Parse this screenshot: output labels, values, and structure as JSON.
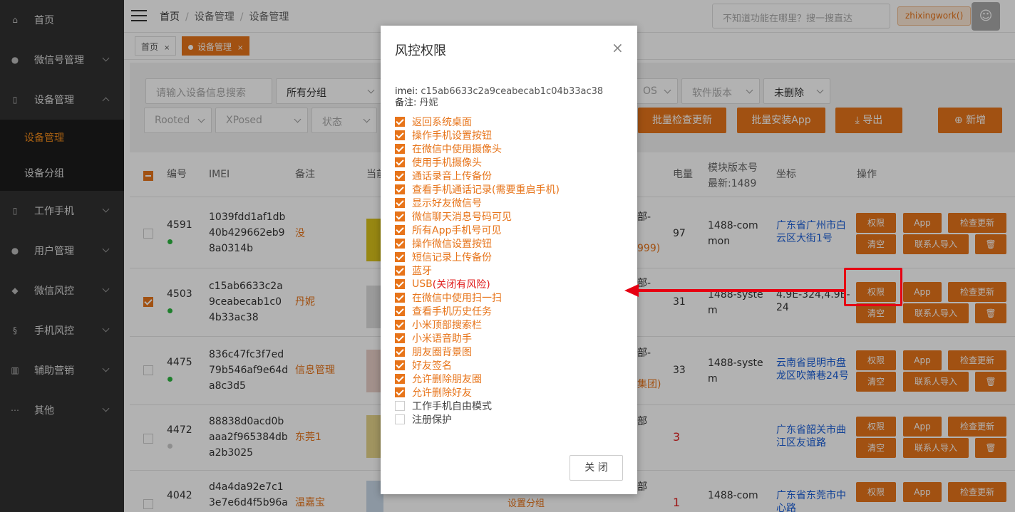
{
  "sidebar": {
    "items": [
      {
        "label": "首页",
        "icon": "home-icon"
      },
      {
        "label": "微信号管理",
        "icon": "wechat-icon"
      },
      {
        "label": "设备管理",
        "icon": "phone-icon"
      },
      {
        "label": "工作手机",
        "icon": "phone-icon"
      },
      {
        "label": "用户管理",
        "icon": "user-icon"
      },
      {
        "label": "微信风控",
        "icon": "shield-icon"
      },
      {
        "label": "手机风控",
        "icon": "fingerprint-icon"
      },
      {
        "label": "辅助营销",
        "icon": "chart-icon"
      },
      {
        "label": "其他",
        "icon": "more-icon"
      }
    ],
    "submenu": [
      "设备管理",
      "设备分组"
    ]
  },
  "header": {
    "breadcrumb": [
      "首页",
      "设备管理",
      "设备管理"
    ],
    "search_placeholder": "不知道功能在哪里？搜一搜直达",
    "user": "zhixingwork()"
  },
  "tabs": [
    {
      "label": "首页",
      "close": "×"
    },
    {
      "label": "设备管理",
      "close": "×"
    }
  ],
  "filters": {
    "search": "请输入设备信息搜索",
    "group": "所有分组",
    "os": "OS",
    "software": "软件版本",
    "deleted": "未删除",
    "rooted": "Rooted",
    "xposed": "XPosed",
    "status": "状态"
  },
  "actions": {
    "batch_check": "批量检查更新",
    "batch_install": "批量安装App",
    "export": "导出",
    "add": "新增"
  },
  "table": {
    "headers": {
      "id": "编号",
      "imei": "IMEI",
      "note": "备注",
      "current": "当前",
      "battery": "电量",
      "module": "模块版本号",
      "module_latest": "最新:1489",
      "coord": "坐标",
      "ops": "操作"
    },
    "rows": [
      {
        "id": "4591",
        "imei": [
          "1039fdd1af1db",
          "40b429662eb9",
          "8a0314b"
        ],
        "note": "没",
        "mid_top": "部-",
        "mid_bottom": "999)",
        "battery": "97",
        "module": [
          "1488-com",
          "mon"
        ],
        "coord": [
          "广东省广州市白",
          "云区大街1号"
        ],
        "online": true
      },
      {
        "id": "4503",
        "imei": [
          "c15ab6633c2a",
          "9ceabecab1c0",
          "4b33ac38"
        ],
        "note": "丹妮",
        "mid_top": "部-",
        "mid_bottom": "",
        "battery": "31",
        "module": [
          "1488-syste",
          "m"
        ],
        "coord": [
          "4.9E-324,4.9E-",
          "24"
        ],
        "online": true
      },
      {
        "id": "4475",
        "imei": [
          "836c47fc3f7ed",
          "79b546af9e64d",
          "a8c3d5"
        ],
        "note": "信息管理",
        "mid_top": "部-",
        "mid_bottom": "集团)",
        "battery": "33",
        "module": [
          "1488-syste",
          "m"
        ],
        "coord": [
          "云南省昆明市盘",
          "龙区吹箫巷24号"
        ],
        "online": true
      },
      {
        "id": "4472",
        "imei": [
          "88838d0acd0b",
          "aaa2f965384db",
          "a2b3025"
        ],
        "note": "东莞1",
        "mid_top": "部",
        "mid_bottom": "",
        "battery": "3",
        "module": [
          "",
          ""
        ],
        "coord": [
          "广东省韶关市曲",
          "江区友谊路"
        ],
        "online": false
      },
      {
        "id": "4042",
        "imei": [
          "d4a4da92e7c1",
          "3e7e6d4f5b96a",
          ""
        ],
        "note": "温嘉宝",
        "mid_top": "部",
        "mid_bottom": "设置分组",
        "battery": "1",
        "module": [
          "1488-com",
          ""
        ],
        "coord": [
          "广东省东莞市中",
          "心路"
        ],
        "online": false
      }
    ],
    "row_buttons": {
      "perm": "权限",
      "app": "App",
      "check": "检查更新",
      "clear": "清空",
      "contacts": "联系人导入",
      "delete": "trash-icon"
    }
  },
  "modal": {
    "title": "风控权限",
    "close_icon": "×",
    "imei_label": "imei:",
    "imei_value": "c15ab6633c2a9ceabecab1c04b33ac38",
    "note_label": "备注:",
    "note_value": "丹妮",
    "permissions": [
      {
        "label": "返回系统桌面",
        "checked": true
      },
      {
        "label": "操作手机设置按钮",
        "checked": true
      },
      {
        "label": "在微信中使用摄像头",
        "checked": true
      },
      {
        "label": "使用手机摄像头",
        "checked": true
      },
      {
        "label": "通话录音上传备份",
        "checked": true
      },
      {
        "label": "查看手机通话记录(需要重启手机)",
        "checked": true
      },
      {
        "label": "显示好友微信号",
        "checked": true
      },
      {
        "label": "微信聊天消息号码可见",
        "checked": true
      },
      {
        "label": "所有App手机号可见",
        "checked": true
      },
      {
        "label": "操作微信设置按钮",
        "checked": true
      },
      {
        "label": "短信记录上传备份",
        "checked": true
      },
      {
        "label": "蓝牙",
        "checked": true
      },
      {
        "label": "USB",
        "risk": "(关闭有风险)",
        "checked": true
      },
      {
        "label": "在微信中使用扫一扫",
        "checked": true
      },
      {
        "label": "查看手机历史任务",
        "checked": true
      },
      {
        "label": "小米顶部搜索栏",
        "checked": true
      },
      {
        "label": "小米语音助手",
        "checked": true
      },
      {
        "label": "朋友圈背景图",
        "checked": true
      },
      {
        "label": "好友签名",
        "checked": true
      },
      {
        "label": "允许删除朋友圈",
        "checked": true
      },
      {
        "label": "允许删除好友",
        "checked": true
      },
      {
        "label": "工作手机自由模式",
        "checked": false
      },
      {
        "label": "注册保护",
        "checked": false
      }
    ],
    "close_button": "关 闭"
  },
  "colors": {
    "accent": "#e7741a",
    "sidebar": "#323232",
    "annotation": "#e60012",
    "link": "#1b5fd8"
  }
}
